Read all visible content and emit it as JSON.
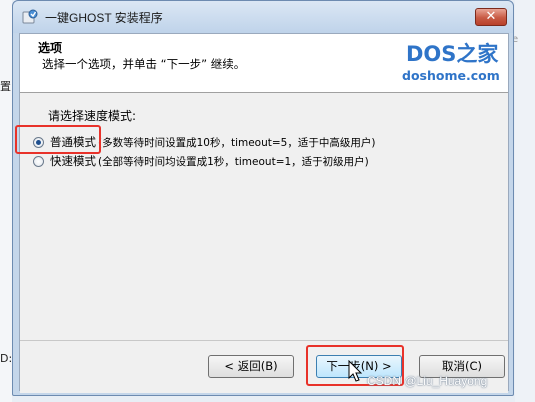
{
  "background": {
    "left_text_top": "置",
    "left_text_bottom": "D:)",
    "right_text": "e"
  },
  "window": {
    "title": "一键GHOST 安装程序",
    "close_label": "✕"
  },
  "header": {
    "title": "选项",
    "subtitle": "选择一个选项，并单击 “下一步” 继续。",
    "logo_main": "DOS之家",
    "logo_sub": "doshome.com"
  },
  "body": {
    "prompt": "请选择速度模式:",
    "options": [
      {
        "label": "普通模式",
        "description": "(多数等待时间设置成10秒，timeout=5，适于中高级用户)",
        "checked": true
      },
      {
        "label": "快速模式",
        "description": "(全部等待时间均设置成1秒，timeout=1，适于初级用户)",
        "checked": false
      }
    ]
  },
  "footer": {
    "back_label": "< 返回(B)",
    "next_label": "下一步(N) >",
    "cancel_label": "取消(C)"
  },
  "watermark": "CSDN @Liu_Huayong",
  "colors": {
    "highlight": "#e8322a",
    "logo": "#2f74c8"
  }
}
